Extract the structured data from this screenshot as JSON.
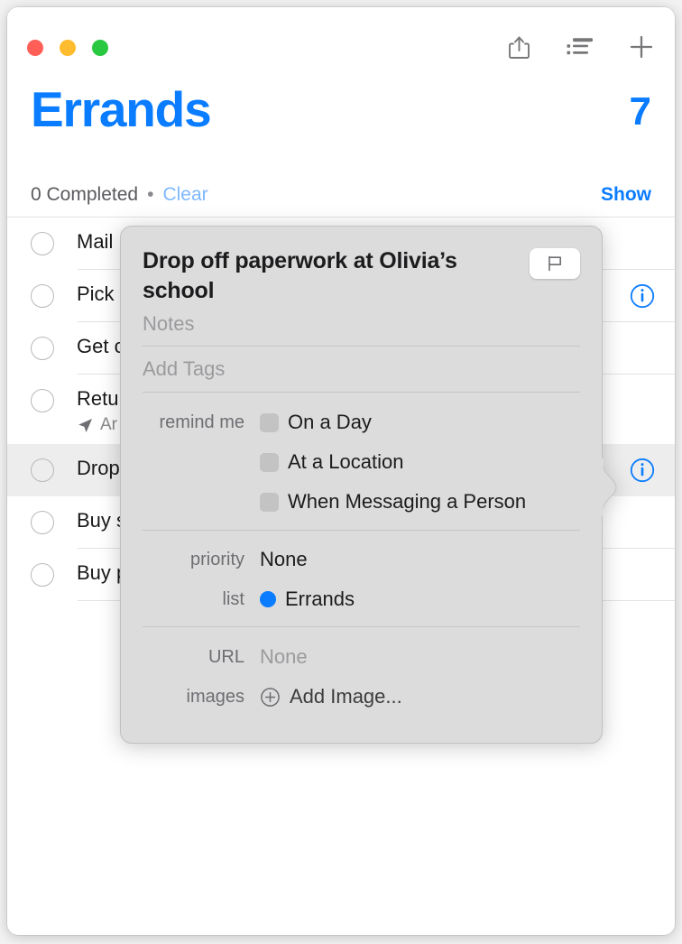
{
  "window": {
    "traffic_lights": [
      {
        "name": "close",
        "color": "#ff5f57"
      },
      {
        "name": "minimize",
        "color": "#febc2e"
      },
      {
        "name": "zoom",
        "color": "#28c840"
      }
    ]
  },
  "toolbar": {
    "share_icon": "share-icon",
    "sort_icon": "list-sort-icon",
    "add_icon": "plus-icon"
  },
  "header": {
    "title": "Errands",
    "count": "7",
    "accent_color": "#0a7cff"
  },
  "subheader": {
    "completed_text": "0 Completed",
    "separator": "•",
    "clear_label": "Clear",
    "show_label": "Show"
  },
  "reminders": [
    {
      "title": "Mail",
      "subtitle": "",
      "selected": false,
      "has_info": false
    },
    {
      "title": "Pick",
      "subtitle": "",
      "selected": false,
      "has_info": true
    },
    {
      "title": "Get c",
      "subtitle": "",
      "selected": false,
      "has_info": false
    },
    {
      "title": "Retu",
      "subtitle": "Ar",
      "selected": false,
      "has_info": false
    },
    {
      "title": "Drop",
      "subtitle": "",
      "selected": true,
      "has_info": true
    },
    {
      "title": "Buy s",
      "subtitle": "",
      "selected": false,
      "has_info": false
    },
    {
      "title": "Buy p",
      "subtitle": "",
      "selected": false,
      "has_info": false
    }
  ],
  "popover": {
    "title": "Drop off paperwork at Olivia’s school",
    "flag_icon": "flag-icon",
    "notes_placeholder": "Notes",
    "tags_placeholder": "Add Tags",
    "remind_label": "remind me",
    "remind_options": [
      {
        "label": "On a Day",
        "checked": false
      },
      {
        "label": "At a Location",
        "checked": false
      },
      {
        "label": "When Messaging a Person",
        "checked": false
      }
    ],
    "priority_label": "priority",
    "priority_value": "None",
    "list_label": "list",
    "list_value": "Errands",
    "list_color": "#0a7cff",
    "url_label": "URL",
    "url_value": "None",
    "images_label": "images",
    "images_action": "Add Image...",
    "add_image_icon": "plus-circle-icon"
  }
}
